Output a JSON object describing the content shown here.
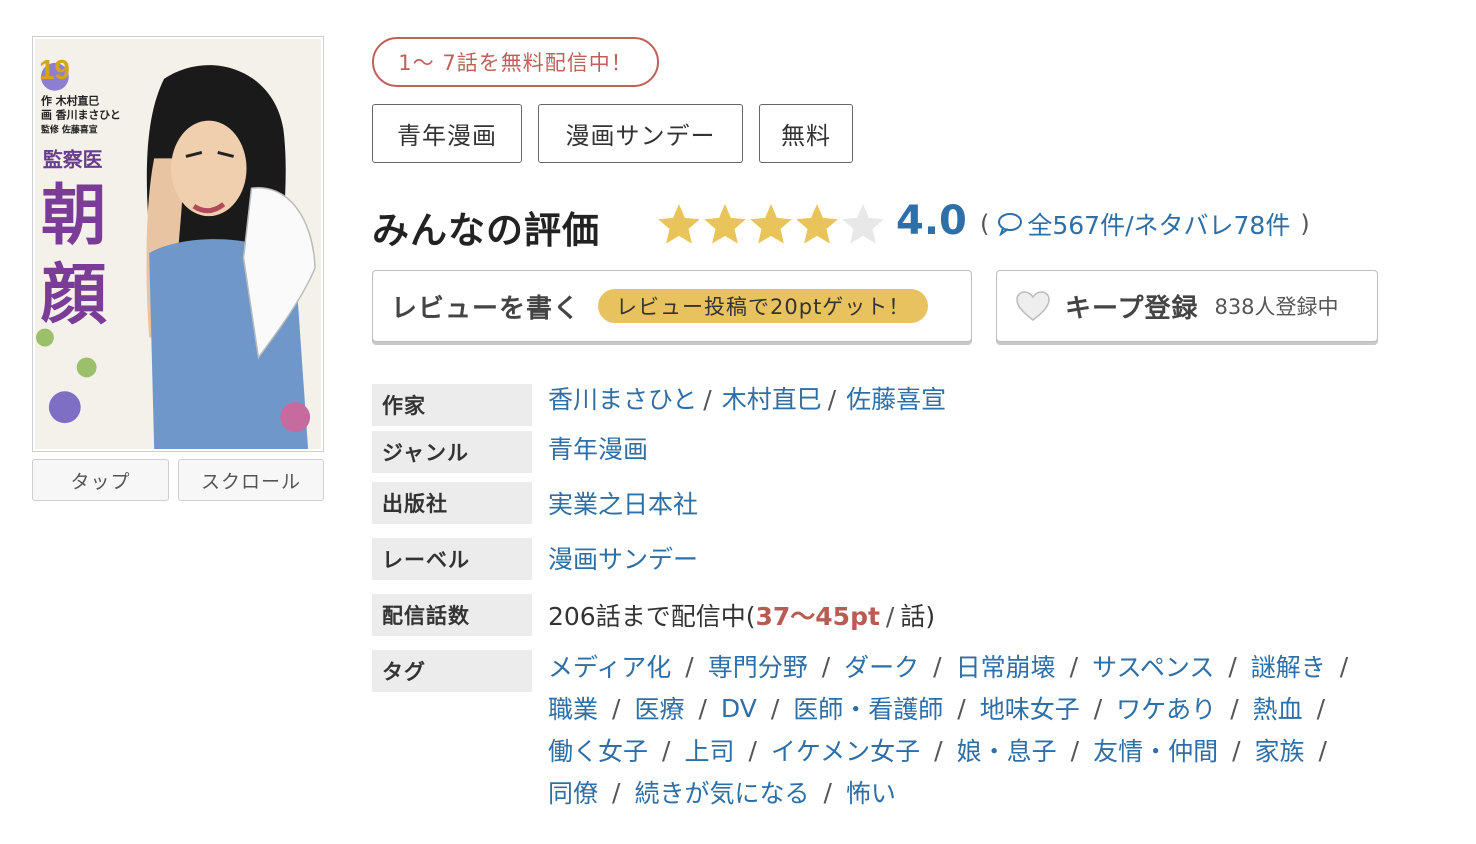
{
  "badge": {
    "free": "1〜 7話を無料配信中！"
  },
  "category_tags": [
    "青年漫画",
    "漫画サンデー",
    "無料"
  ],
  "cover": {
    "volume": "19",
    "series_sub": "監察医",
    "title_1": "朝",
    "title_2": "顔",
    "credit_1": "作 木村直巳",
    "credit_2": "画 香川まさひと",
    "credit_3": "監修 佐藤喜宣"
  },
  "reader_buttons": {
    "tap": "タップ",
    "scroll": "スクロール"
  },
  "rating": {
    "title": "みんなの評価",
    "score": "4.0",
    "stars_filled": 4,
    "stars_total": 5,
    "open_paren": "(",
    "close_paren": ")",
    "counts": "全567件/ネタバレ78件"
  },
  "review_button": {
    "label": "レビューを書く",
    "bonus": "レビュー投稿で20ptゲット！"
  },
  "keep_button": {
    "label": "キープ登録",
    "count": "838人登録中"
  },
  "info": {
    "author": {
      "label": "作家",
      "names": [
        "香川まさひと",
        "木村直巳",
        "佐藤喜宣"
      ],
      "separator": "/"
    },
    "genre": {
      "label": "ジャンル",
      "value": "青年漫画"
    },
    "publisher": {
      "label": "出版社",
      "value": "実業之日本社"
    },
    "label_row": {
      "label": "レーベル",
      "value": "漫画サンデー"
    },
    "delivery": {
      "label": "配信話数",
      "prefix": "206話まで配信中(",
      "price": "37〜45pt",
      "slash": "/",
      "suffix": "話)"
    },
    "tags": {
      "label": "タグ",
      "separator": "/",
      "lines": [
        [
          "メディア化",
          "専門分野",
          "ダーク",
          "日常崩壊",
          "サスペンス",
          "謎解き"
        ],
        [
          "職業",
          "医療",
          "DV",
          "医師・看護師",
          "地味女子",
          "ワケあり",
          "熱血"
        ],
        [
          "働く女子",
          "上司",
          "イケメン女子",
          "娘・息子",
          "友情・仲間",
          "家族"
        ],
        [
          "同僚",
          "続きが気になる",
          "怖い"
        ]
      ]
    }
  },
  "colors": {
    "link": "#2e6fa7",
    "star_on": "#e9c45a",
    "star_off": "#e8e8e8",
    "badge": "#c0605a",
    "price": "#b85c53",
    "bonus_bg": "#e8c25f"
  }
}
